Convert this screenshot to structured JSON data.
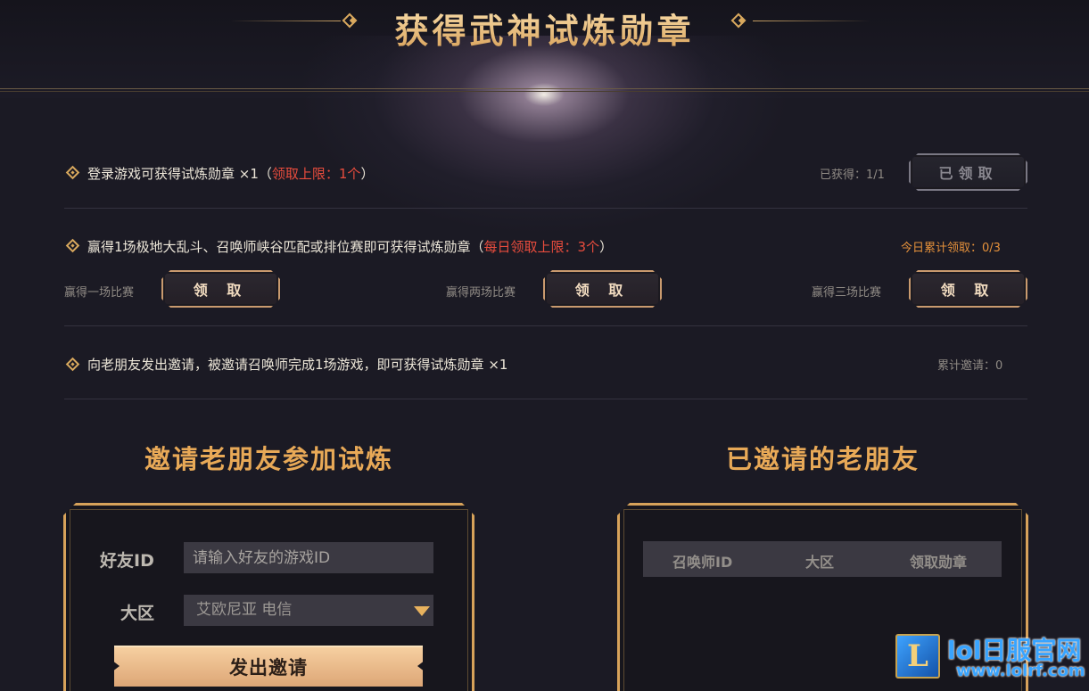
{
  "header": {
    "title": "获得武神试炼勋章"
  },
  "tasks": [
    {
      "text": "登录游戏可获得试炼勋章 ×1（",
      "highlight": "领取上限：1个",
      "text_end": "）",
      "status": "已获得：1/1",
      "button": "已领取"
    },
    {
      "text": "赢得1场极地大乱斗、召唤师峡谷匹配或排位赛即可获得试炼勋章（",
      "highlight": "每日领取上限：3个",
      "text_end": "）",
      "status": "今日累计领取：0/3",
      "claims": [
        {
          "label": "赢得一场比赛",
          "button": "领 取"
        },
        {
          "label": "赢得两场比赛",
          "button": "领 取"
        },
        {
          "label": "赢得三场比赛",
          "button": "领 取"
        }
      ]
    },
    {
      "text": "向老朋友发出邀请，被邀请召唤师完成1场游戏，即可获得试炼勋章 ×1",
      "status": "累计邀请：0"
    }
  ],
  "invite": {
    "title": "邀请老朋友参加试炼",
    "friend_id_label": "好友ID",
    "friend_id_placeholder": "请输入好友的游戏ID",
    "region_label": "大区",
    "region_value": "艾欧尼亚 电信",
    "submit_label": "发出邀请"
  },
  "invited": {
    "title": "已邀请的老朋友",
    "columns": [
      "召唤师ID",
      "大区",
      "领取勋章"
    ]
  },
  "watermark": {
    "logo_letter": "L",
    "text": "lol日服官网",
    "url": "www.lolrf.com"
  },
  "colors": {
    "accent_gold": "#d9a95e",
    "highlight_red": "#e84c3d",
    "status_orange": "#e5913b",
    "background": "#1b1a24"
  },
  "icons": {
    "task_bullet": "diamond-bullet-icon",
    "dropdown": "dropdown-triangle-icon"
  }
}
